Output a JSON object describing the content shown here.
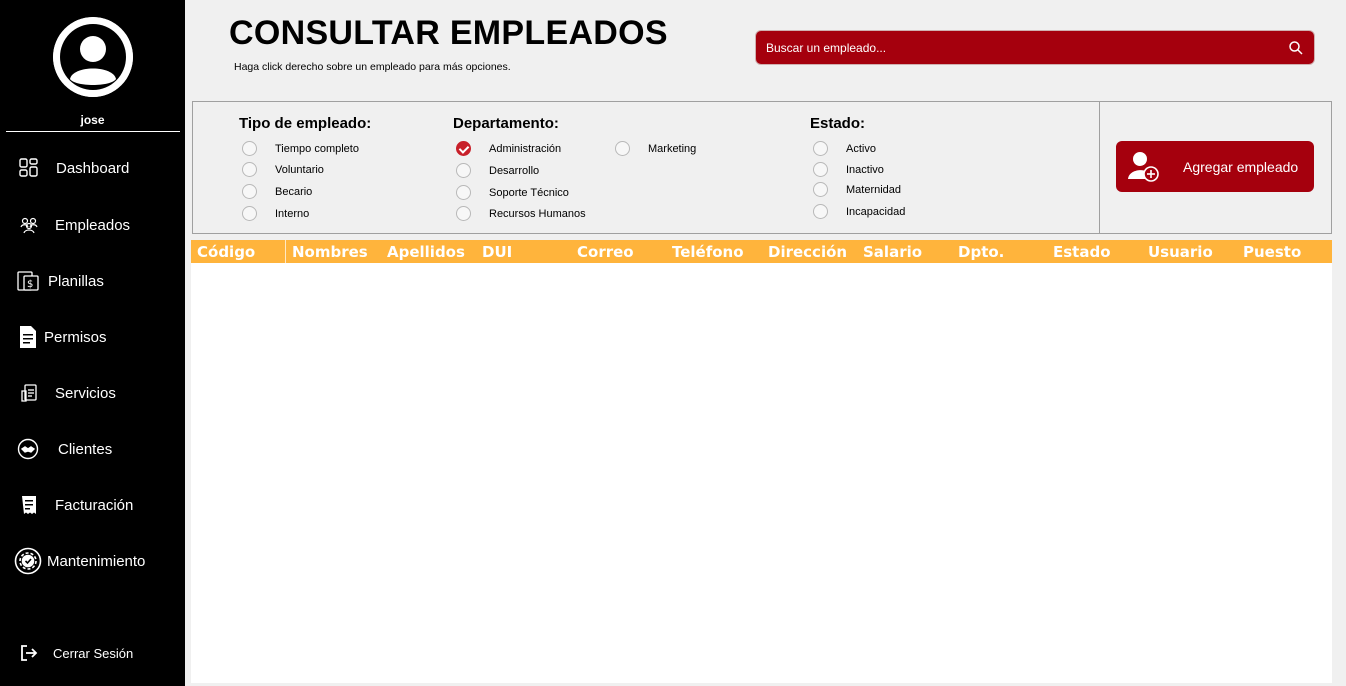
{
  "sidebar": {
    "username": "jose",
    "items": [
      {
        "label": "Dashboard",
        "icon": "dashboard-grid-icon"
      },
      {
        "label": "Empleados",
        "icon": "people-group-icon"
      },
      {
        "label": "Planillas",
        "icon": "payroll-icon"
      },
      {
        "label": "Permisos",
        "icon": "document-icon"
      },
      {
        "label": "Servicios",
        "icon": "clipboard-icon"
      },
      {
        "label": "Clientes",
        "icon": "handshake-icon"
      },
      {
        "label": "Facturación",
        "icon": "invoice-icon"
      },
      {
        "label": "Mantenimiento",
        "icon": "gear-check-icon"
      }
    ],
    "logout_label": "Cerrar Sesión"
  },
  "header": {
    "title": "CONSULTAR EMPLEADOS",
    "subtitle": "Haga click derecho sobre un empleado para más opciones.",
    "search_placeholder": "Buscar un empleado..."
  },
  "filters": {
    "tipo": {
      "title": "Tipo de empleado:",
      "options": [
        "Tiempo completo",
        "Voluntario",
        "Becario",
        "Interno"
      ]
    },
    "departamento": {
      "title": "Departamento:",
      "options": [
        "Administración",
        "Desarrollo",
        "Soporte Técnico",
        "Recursos Humanos",
        "Marketing"
      ],
      "selected": "Administración"
    },
    "estado": {
      "title": "Estado:",
      "options": [
        "Activo",
        "Inactivo",
        "Maternidad",
        "Incapacidad"
      ]
    }
  },
  "add_button_label": "Agregar empleado",
  "table": {
    "columns": [
      "Código",
      "Nombres",
      "Apellidos",
      "DUI",
      "Correo",
      "Teléfono",
      "Dirección",
      "Salario",
      "Dpto.",
      "Estado",
      "Usuario",
      "Puesto"
    ],
    "rows": []
  },
  "colors": {
    "sidebar_bg": "#000000",
    "accent_red": "#a5000d",
    "header_orange": "#ffb43c"
  }
}
